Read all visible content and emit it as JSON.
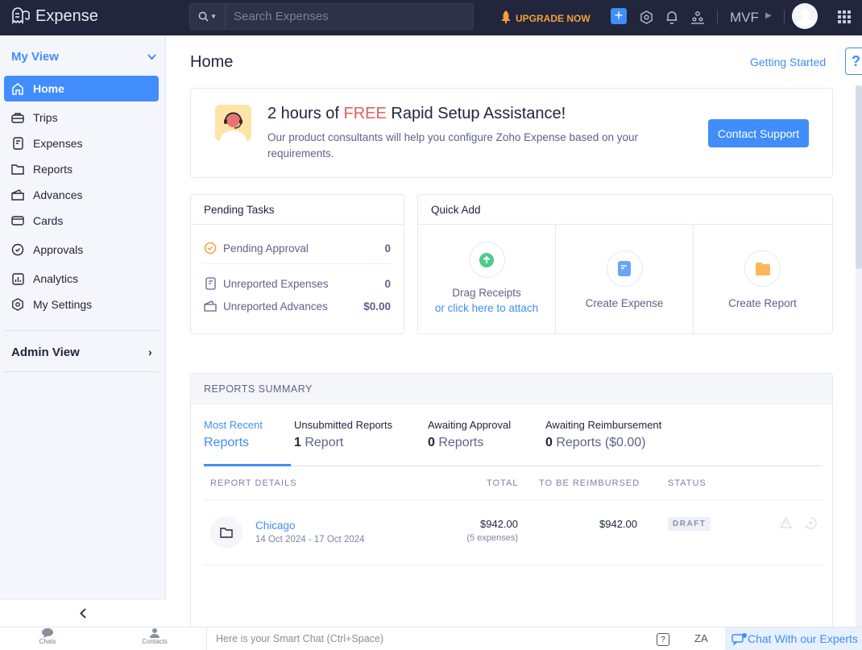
{
  "app": {
    "name": "Expense"
  },
  "search": {
    "placeholder": "Search Expenses"
  },
  "topbar": {
    "upgrade_label": "UPGRADE NOW",
    "org_label": "MVF",
    "icons": [
      "plus-icon",
      "gear-icon",
      "bell-icon",
      "users-icon",
      "apps-grid-icon"
    ]
  },
  "sidebar": {
    "my_view_label": "My View",
    "items": [
      {
        "label": "Home",
        "icon": "home-icon",
        "active": true
      },
      {
        "label": "Trips",
        "icon": "briefcase-icon"
      },
      {
        "label": "Expenses",
        "icon": "receipt-icon"
      },
      {
        "label": "Reports",
        "icon": "folder-icon"
      },
      {
        "label": "Advances",
        "icon": "wallet-icon"
      },
      {
        "label": "Cards",
        "icon": "card-icon"
      },
      {
        "label": "Approvals",
        "icon": "check-circle-icon"
      },
      {
        "label": "Analytics",
        "icon": "chart-icon"
      },
      {
        "label": "My Settings",
        "icon": "gear-icon"
      }
    ],
    "admin_view_label": "Admin View",
    "collapse_icon": "chevron-left-icon"
  },
  "main": {
    "title": "Home",
    "getting_started": "Getting Started",
    "help_label": "?"
  },
  "banner": {
    "title_pre": "2 hours of ",
    "title_free": "FREE",
    "title_post": " Rapid Setup Assistance!",
    "description": "Our product consultants will help you configure Zoho Expense based on your requirements.",
    "button": "Contact Support",
    "colors": {
      "free": "#e85d5d",
      "button": "#408dfb"
    }
  },
  "pending_tasks": {
    "title": "Pending Tasks",
    "items": [
      {
        "label": "Pending Approval",
        "value": "0",
        "icon": "check-circle-icon"
      },
      {
        "label": "Unreported Expenses",
        "value": "0",
        "icon": "receipt-icon"
      },
      {
        "label": "Unreported Advances",
        "value": "$0.00",
        "icon": "wallet-icon"
      }
    ]
  },
  "quick_add": {
    "title": "Quick Add",
    "items": [
      {
        "label": "Drag Receipts",
        "link": "or click here to attach",
        "icon": "upload-icon"
      },
      {
        "label": "Create Expense",
        "icon": "receipt-icon"
      },
      {
        "label": "Create Report",
        "icon": "folder-icon"
      }
    ]
  },
  "reports_summary": {
    "title": "REPORTS SUMMARY",
    "tabs": [
      {
        "line1": "Most Recent",
        "line2_count": "",
        "line2": "Reports",
        "active": true
      },
      {
        "line1": "Unsubmitted Reports",
        "line2_count": "1",
        "line2": " Report"
      },
      {
        "line1": "Awaiting Approval",
        "line2_count": "0",
        "line2": " Reports"
      },
      {
        "line1": "Awaiting Reimbursement",
        "line2_count": "0",
        "line2": " Reports ($0.00)"
      }
    ],
    "columns": [
      "REPORT DETAILS",
      "TOTAL",
      "TO BE REIMBURSED",
      "STATUS"
    ],
    "rows": [
      {
        "name": "Chicago",
        "date_range": "14 Oct 2024 - 17 Oct 2024",
        "total": "$942.00",
        "expense_count": "(5 expenses)",
        "to_be_reimbursed": "$942.00",
        "status": "DRAFT"
      }
    ]
  },
  "bottom_bar": {
    "chats": "Chats",
    "contacts": "Contacts",
    "smart_chat_placeholder": "Here is your Smart Chat (Ctrl+Space)",
    "chat_experts": "Chat With our Experts"
  }
}
